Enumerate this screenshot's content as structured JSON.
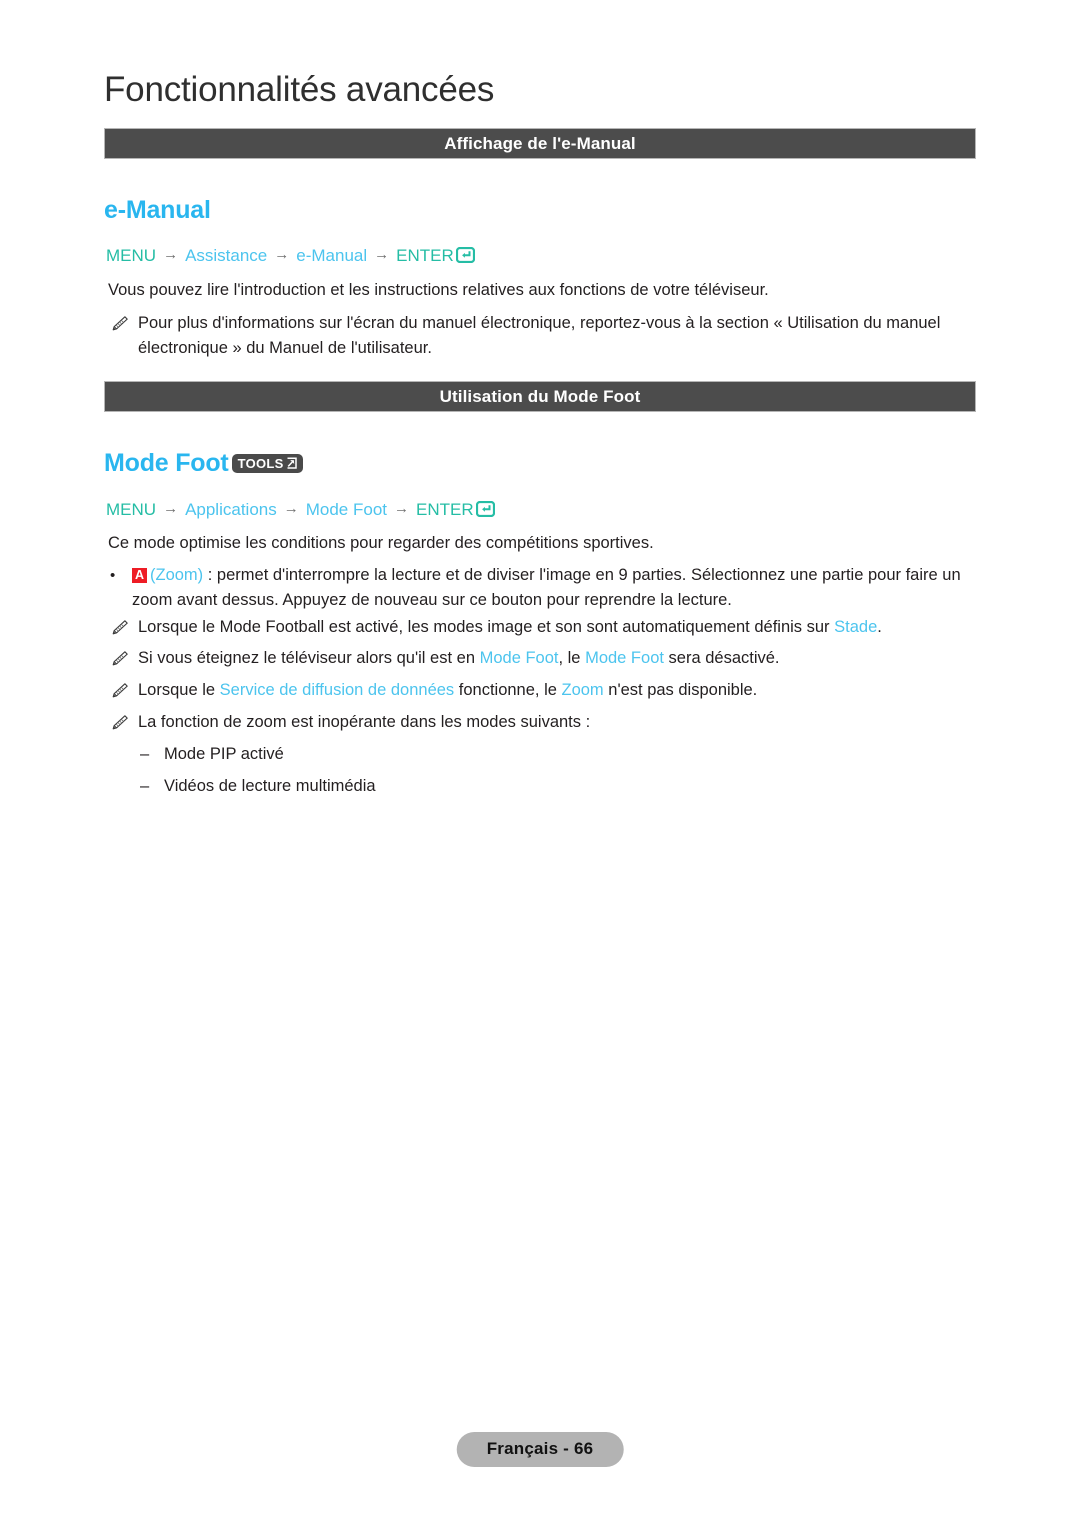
{
  "page": {
    "chapter_title": "Fonctionnalités avancées",
    "footer_label": "Français - 66"
  },
  "colors": {
    "heading_blue": "#29b6ef",
    "term_blue": "#4cc4ee",
    "path_key_teal": "#25bda5",
    "bar_gray": "#4c4c4c",
    "key_badge_red": "#ee1c25",
    "footer_pill_gray": "#b3b3b3"
  },
  "sections": [
    {
      "bar_label": "Affichage de l'e-Manual",
      "heading": "e-Manual",
      "path": {
        "menu": "MENU",
        "arrow": "→",
        "step1": "Assistance",
        "step2": "e-Manual",
        "enter": "ENTER",
        "enter_icon": "enter-return-icon"
      },
      "intro": "Vous pouvez lire l'introduction et les instructions relatives aux fonctions de votre téléviseur.",
      "notes": [
        "Pour plus d'informations sur l'écran du manuel électronique, reportez-vous à la section « Utilisation du manuel électronique » du Manuel de l'utilisateur."
      ]
    },
    {
      "bar_label": "Utilisation du Mode Foot",
      "heading": "Mode Foot",
      "tools_badge": {
        "label": "TOOLS",
        "icon": "tools-arrow-icon"
      },
      "path": {
        "menu": "MENU",
        "arrow": "→",
        "step1": "Applications",
        "step2": "Mode Foot",
        "enter": "ENTER",
        "enter_icon": "enter-return-icon"
      },
      "intro": "Ce mode optimise les conditions pour regarder des compétitions sportives.",
      "dot_item": {
        "key_badge": "A",
        "term": "(Zoom)",
        "text": " : permet d'interrompre la lecture et de diviser l'image en 9 parties. Sélectionnez une partie pour faire un zoom avant dessus. Appuyez de nouveau sur ce bouton pour reprendre la lecture."
      },
      "notes": [
        {
          "parts": [
            {
              "t": "Lorsque le Mode Football est activé, les modes image et son sont automatiquement définis sur ",
              "s": "plain"
            },
            {
              "t": "Stade",
              "s": "term"
            },
            {
              "t": ".",
              "s": "plain"
            }
          ]
        },
        {
          "parts": [
            {
              "t": "Si vous éteignez le téléviseur alors qu'il est en ",
              "s": "plain"
            },
            {
              "t": "Mode Foot",
              "s": "term"
            },
            {
              "t": ", le ",
              "s": "plain"
            },
            {
              "t": "Mode Foot",
              "s": "term"
            },
            {
              "t": " sera désactivé.",
              "s": "plain"
            }
          ]
        },
        {
          "parts": [
            {
              "t": "Lorsque le ",
              "s": "plain"
            },
            {
              "t": "Service de diffusion de données",
              "s": "term"
            },
            {
              "t": " fonctionne, le ",
              "s": "plain"
            },
            {
              "t": "Zoom",
              "s": "term"
            },
            {
              "t": " n'est pas disponible.",
              "s": "plain"
            }
          ]
        },
        {
          "parts": [
            {
              "t": "La fonction de zoom est inopérante dans les modes suivants :",
              "s": "plain"
            }
          ]
        }
      ],
      "dash_items": [
        {
          "dash": "–",
          "label": "Mode PIP activé"
        },
        {
          "dash": "–",
          "label": "Vidéos de lecture multimédia"
        }
      ]
    }
  ]
}
